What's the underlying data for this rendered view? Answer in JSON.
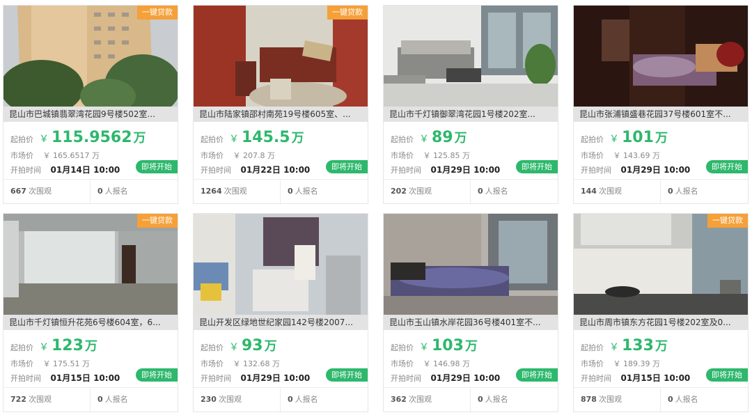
{
  "labels": {
    "start_price": "起拍价",
    "market_price": "市场价",
    "start_time": "开拍时间",
    "views_suffix": "次围观",
    "signup_suffix": "人报名",
    "yen": "￥",
    "wan": "万"
  },
  "listings": [
    {
      "title": "昆山市巴城镇翡翠湾花园9号楼502室...",
      "badge": "一键贷款",
      "start_price": "115.9562",
      "market_price": "￥ 165.6517 万",
      "start_time": "01月14日 10:00",
      "status": "即将开始",
      "views": "667",
      "signups": "0"
    },
    {
      "title": "昆山市陆家镇邵村南苑19号楼605室、...",
      "badge": "一键贷款",
      "start_price": "145.5",
      "market_price": "￥ 207.8 万",
      "start_time": "01月22日 10:00",
      "status": "即将开始",
      "views": "1264",
      "signups": "0"
    },
    {
      "title": "昆山市千灯镇御翠湾花园1号楼202室...",
      "badge": "",
      "start_price": "89",
      "market_price": "￥ 125.85 万",
      "start_time": "01月29日 10:00",
      "status": "即将开始",
      "views": "202",
      "signups": "0"
    },
    {
      "title": "昆山市张浦镇盛巷花园37号楼601室不...",
      "badge": "",
      "start_price": "101",
      "market_price": "￥ 143.69 万",
      "start_time": "01月29日 10:00",
      "status": "即将开始",
      "views": "144",
      "signups": "0"
    },
    {
      "title": "昆山市千灯镇恒升花苑6号楼604室，6...",
      "badge": "一键贷款",
      "start_price": "123",
      "market_price": "￥ 175.51 万",
      "start_time": "01月15日 10:00",
      "status": "即将开始",
      "views": "722",
      "signups": "0"
    },
    {
      "title": "昆山开发区绿地世纪家园142号楼2007...",
      "badge": "",
      "start_price": "93",
      "market_price": "￥ 132.68 万",
      "start_time": "01月29日 10:00",
      "status": "即将开始",
      "views": "230",
      "signups": "0"
    },
    {
      "title": "昆山市玉山镇水岸花园36号楼401室不...",
      "badge": "",
      "start_price": "103",
      "market_price": "￥ 146.98 万",
      "start_time": "01月29日 10:00",
      "status": "即将开始",
      "views": "362",
      "signups": "0"
    },
    {
      "title": "昆山市周市镇东方花园1号楼202室及0...",
      "badge": "一键贷款",
      "start_price": "133",
      "market_price": "￥ 189.39 万",
      "start_time": "01月15日 10:00",
      "status": "即将开始",
      "views": "878",
      "signups": "0"
    }
  ]
}
